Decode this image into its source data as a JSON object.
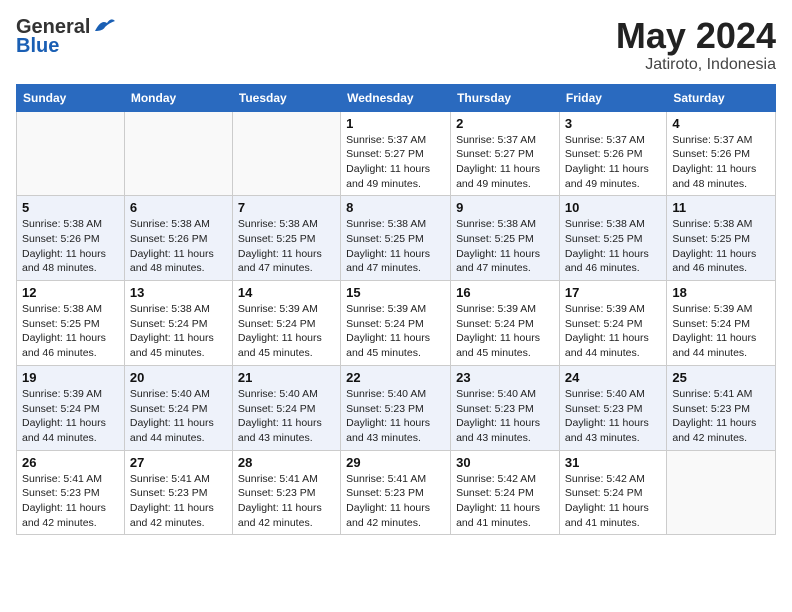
{
  "header": {
    "logo_general": "General",
    "logo_blue": "Blue",
    "month_year": "May 2024",
    "location": "Jatiroto, Indonesia"
  },
  "days_of_week": [
    "Sunday",
    "Monday",
    "Tuesday",
    "Wednesday",
    "Thursday",
    "Friday",
    "Saturday"
  ],
  "weeks": [
    [
      {
        "day": "",
        "sunrise": "",
        "sunset": "",
        "daylight": ""
      },
      {
        "day": "",
        "sunrise": "",
        "sunset": "",
        "daylight": ""
      },
      {
        "day": "",
        "sunrise": "",
        "sunset": "",
        "daylight": ""
      },
      {
        "day": "1",
        "sunrise": "Sunrise: 5:37 AM",
        "sunset": "Sunset: 5:27 PM",
        "daylight": "Daylight: 11 hours and 49 minutes."
      },
      {
        "day": "2",
        "sunrise": "Sunrise: 5:37 AM",
        "sunset": "Sunset: 5:27 PM",
        "daylight": "Daylight: 11 hours and 49 minutes."
      },
      {
        "day": "3",
        "sunrise": "Sunrise: 5:37 AM",
        "sunset": "Sunset: 5:26 PM",
        "daylight": "Daylight: 11 hours and 49 minutes."
      },
      {
        "day": "4",
        "sunrise": "Sunrise: 5:37 AM",
        "sunset": "Sunset: 5:26 PM",
        "daylight": "Daylight: 11 hours and 48 minutes."
      }
    ],
    [
      {
        "day": "5",
        "sunrise": "Sunrise: 5:38 AM",
        "sunset": "Sunset: 5:26 PM",
        "daylight": "Daylight: 11 hours and 48 minutes."
      },
      {
        "day": "6",
        "sunrise": "Sunrise: 5:38 AM",
        "sunset": "Sunset: 5:26 PM",
        "daylight": "Daylight: 11 hours and 48 minutes."
      },
      {
        "day": "7",
        "sunrise": "Sunrise: 5:38 AM",
        "sunset": "Sunset: 5:25 PM",
        "daylight": "Daylight: 11 hours and 47 minutes."
      },
      {
        "day": "8",
        "sunrise": "Sunrise: 5:38 AM",
        "sunset": "Sunset: 5:25 PM",
        "daylight": "Daylight: 11 hours and 47 minutes."
      },
      {
        "day": "9",
        "sunrise": "Sunrise: 5:38 AM",
        "sunset": "Sunset: 5:25 PM",
        "daylight": "Daylight: 11 hours and 47 minutes."
      },
      {
        "day": "10",
        "sunrise": "Sunrise: 5:38 AM",
        "sunset": "Sunset: 5:25 PM",
        "daylight": "Daylight: 11 hours and 46 minutes."
      },
      {
        "day": "11",
        "sunrise": "Sunrise: 5:38 AM",
        "sunset": "Sunset: 5:25 PM",
        "daylight": "Daylight: 11 hours and 46 minutes."
      }
    ],
    [
      {
        "day": "12",
        "sunrise": "Sunrise: 5:38 AM",
        "sunset": "Sunset: 5:25 PM",
        "daylight": "Daylight: 11 hours and 46 minutes."
      },
      {
        "day": "13",
        "sunrise": "Sunrise: 5:38 AM",
        "sunset": "Sunset: 5:24 PM",
        "daylight": "Daylight: 11 hours and 45 minutes."
      },
      {
        "day": "14",
        "sunrise": "Sunrise: 5:39 AM",
        "sunset": "Sunset: 5:24 PM",
        "daylight": "Daylight: 11 hours and 45 minutes."
      },
      {
        "day": "15",
        "sunrise": "Sunrise: 5:39 AM",
        "sunset": "Sunset: 5:24 PM",
        "daylight": "Daylight: 11 hours and 45 minutes."
      },
      {
        "day": "16",
        "sunrise": "Sunrise: 5:39 AM",
        "sunset": "Sunset: 5:24 PM",
        "daylight": "Daylight: 11 hours and 45 minutes."
      },
      {
        "day": "17",
        "sunrise": "Sunrise: 5:39 AM",
        "sunset": "Sunset: 5:24 PM",
        "daylight": "Daylight: 11 hours and 44 minutes."
      },
      {
        "day": "18",
        "sunrise": "Sunrise: 5:39 AM",
        "sunset": "Sunset: 5:24 PM",
        "daylight": "Daylight: 11 hours and 44 minutes."
      }
    ],
    [
      {
        "day": "19",
        "sunrise": "Sunrise: 5:39 AM",
        "sunset": "Sunset: 5:24 PM",
        "daylight": "Daylight: 11 hours and 44 minutes."
      },
      {
        "day": "20",
        "sunrise": "Sunrise: 5:40 AM",
        "sunset": "Sunset: 5:24 PM",
        "daylight": "Daylight: 11 hours and 44 minutes."
      },
      {
        "day": "21",
        "sunrise": "Sunrise: 5:40 AM",
        "sunset": "Sunset: 5:24 PM",
        "daylight": "Daylight: 11 hours and 43 minutes."
      },
      {
        "day": "22",
        "sunrise": "Sunrise: 5:40 AM",
        "sunset": "Sunset: 5:23 PM",
        "daylight": "Daylight: 11 hours and 43 minutes."
      },
      {
        "day": "23",
        "sunrise": "Sunrise: 5:40 AM",
        "sunset": "Sunset: 5:23 PM",
        "daylight": "Daylight: 11 hours and 43 minutes."
      },
      {
        "day": "24",
        "sunrise": "Sunrise: 5:40 AM",
        "sunset": "Sunset: 5:23 PM",
        "daylight": "Daylight: 11 hours and 43 minutes."
      },
      {
        "day": "25",
        "sunrise": "Sunrise: 5:41 AM",
        "sunset": "Sunset: 5:23 PM",
        "daylight": "Daylight: 11 hours and 42 minutes."
      }
    ],
    [
      {
        "day": "26",
        "sunrise": "Sunrise: 5:41 AM",
        "sunset": "Sunset: 5:23 PM",
        "daylight": "Daylight: 11 hours and 42 minutes."
      },
      {
        "day": "27",
        "sunrise": "Sunrise: 5:41 AM",
        "sunset": "Sunset: 5:23 PM",
        "daylight": "Daylight: 11 hours and 42 minutes."
      },
      {
        "day": "28",
        "sunrise": "Sunrise: 5:41 AM",
        "sunset": "Sunset: 5:23 PM",
        "daylight": "Daylight: 11 hours and 42 minutes."
      },
      {
        "day": "29",
        "sunrise": "Sunrise: 5:41 AM",
        "sunset": "Sunset: 5:23 PM",
        "daylight": "Daylight: 11 hours and 42 minutes."
      },
      {
        "day": "30",
        "sunrise": "Sunrise: 5:42 AM",
        "sunset": "Sunset: 5:24 PM",
        "daylight": "Daylight: 11 hours and 41 minutes."
      },
      {
        "day": "31",
        "sunrise": "Sunrise: 5:42 AM",
        "sunset": "Sunset: 5:24 PM",
        "daylight": "Daylight: 11 hours and 41 minutes."
      },
      {
        "day": "",
        "sunrise": "",
        "sunset": "",
        "daylight": ""
      }
    ]
  ]
}
